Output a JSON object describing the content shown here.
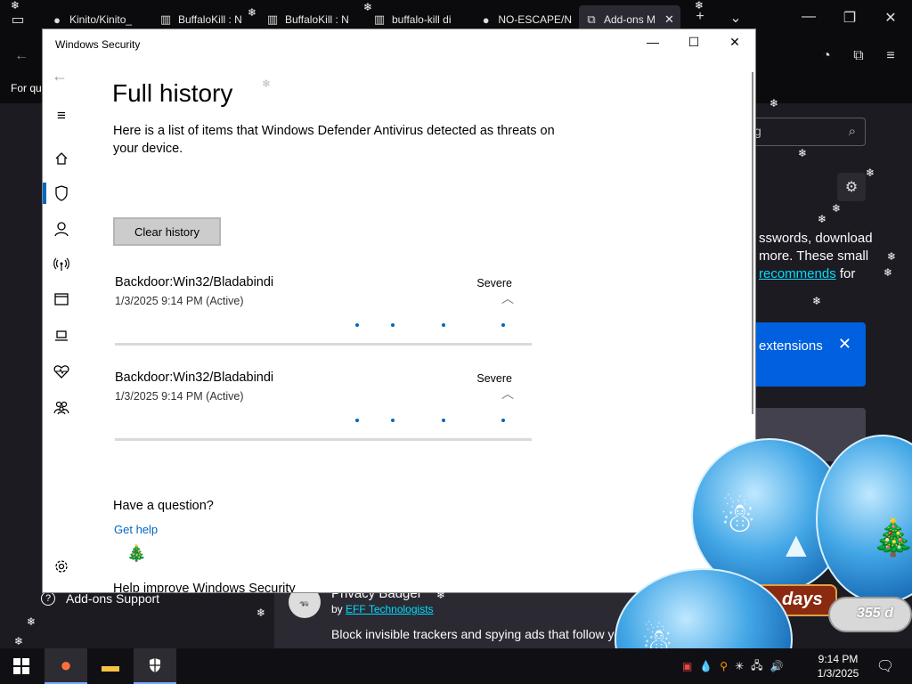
{
  "firefox": {
    "tabs": [
      {
        "label": "Kinito/Kinito_",
        "icon": "github-icon"
      },
      {
        "label": "BuffaloKill : N",
        "icon": "archive-icon"
      },
      {
        "label": "BuffaloKill : N",
        "icon": "archive-icon"
      },
      {
        "label": "buffalo-kill di",
        "icon": "archive-icon"
      },
      {
        "label": "NO-ESCAPE/N",
        "icon": "github-icon"
      },
      {
        "label": "Add-ons M",
        "icon": "puzzle-icon",
        "active": true
      }
    ],
    "bookmarks_peek": "For qu"
  },
  "addons_page": {
    "search_placeholder": "g",
    "body_lines": [
      "sswords, download",
      "more. These small",
      "recommends"
    ],
    "body_suffix": "for",
    "banner_text": "extensions",
    "sidebar_support": "Add-ons Support",
    "addon": {
      "name": "Privacy Badger",
      "by_prefix": "by",
      "author": "EFF Technologists",
      "description": "Block invisible trackers and spying ads that follow yo"
    }
  },
  "windows_security": {
    "window_title": "Windows Security",
    "page_title": "Full history",
    "description": "Here is a list of items that Windows Defender Antivirus detected as threats on your device.",
    "clear_button": "Clear history",
    "threats": [
      {
        "name": "Backdoor:Win32/Bladabindi",
        "date": "1/3/2025 9:14 PM (Active)",
        "severity": "Severe"
      },
      {
        "name": "Backdoor:Win32/Bladabindi",
        "date": "1/3/2025 9:14 PM (Active)",
        "severity": "Severe"
      }
    ],
    "help_heading": "Have a question?",
    "help_link": "Get help",
    "improve_heading": "Help improve Windows Security"
  },
  "snow_globes": {
    "days_label": "days",
    "count_label": "355 d"
  },
  "taskbar": {
    "time": "9:14 PM",
    "date": "1/3/2025"
  },
  "colors": {
    "accent": "#0067c0",
    "ff_link": "#00ddff",
    "banner": "#0060df"
  }
}
